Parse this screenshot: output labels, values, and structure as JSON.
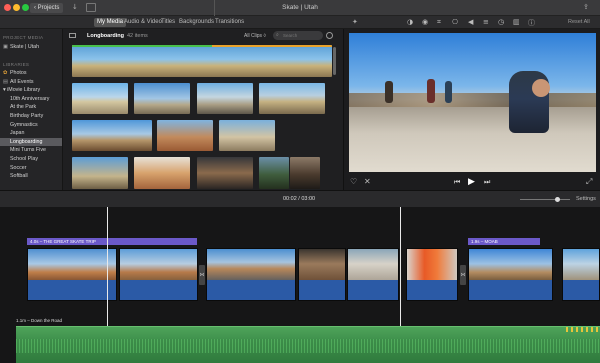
{
  "window": {
    "projects_label": "‹ Projects",
    "title": "Skate | Utah",
    "share_label": "Reset All"
  },
  "toolbar": {
    "tabs": [
      {
        "label": "My Media"
      },
      {
        "label": "Audio & Video"
      },
      {
        "label": "Titles"
      },
      {
        "label": "Backgrounds"
      },
      {
        "label": "Transitions"
      }
    ]
  },
  "sidebar": {
    "project_media_header": "PROJECT MEDIA",
    "project_item": "Skate | Utah",
    "libraries_header": "LIBRARIES",
    "items": [
      {
        "label": "Photos"
      },
      {
        "label": "All Events"
      },
      {
        "label": "▾ iMovie Library"
      },
      {
        "label": "10th Anniversary"
      },
      {
        "label": "At the Park"
      },
      {
        "label": "Birthday Party"
      },
      {
        "label": "Gymnastics"
      },
      {
        "label": "Japan"
      },
      {
        "label": "Longboarding"
      },
      {
        "label": "Mini Turns Five"
      },
      {
        "label": "School Play"
      },
      {
        "label": "Soccer"
      },
      {
        "label": "Softball"
      }
    ],
    "selected_index": 8
  },
  "browser": {
    "event_title": "Longboarding",
    "item_count": "42 items",
    "filter_label": "All Clips ◊",
    "search_placeholder": "Search"
  },
  "timeline": {
    "timecode": "00:02 / 03:00",
    "settings_label": "Settings",
    "title_clip_1": "4.0s – THE GREAT SKATE TRIP",
    "title_clip_2": "1.9s – MOAB",
    "music_label": "1.1m – Down the Road"
  },
  "colors": {
    "accent": "#6b59c9",
    "audio": "#2b5aa6",
    "music": "#3f8b4a",
    "selected": "#5a5a5e"
  }
}
